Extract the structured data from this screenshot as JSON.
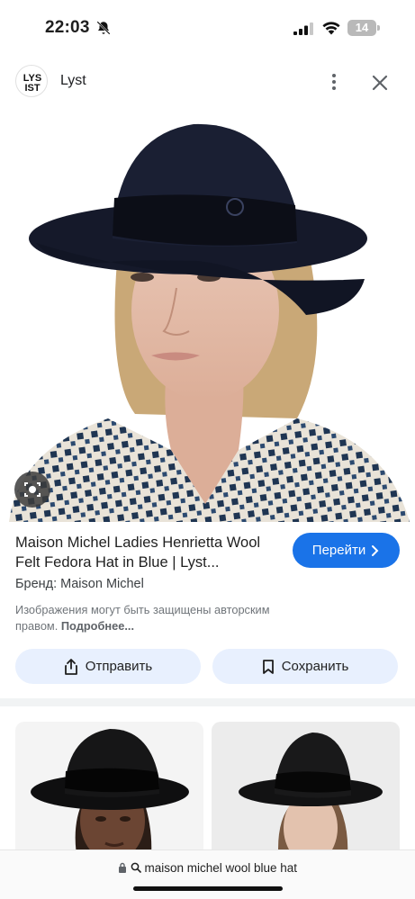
{
  "status_bar": {
    "time": "22:03",
    "battery": "14"
  },
  "header": {
    "logo_text_top": "LYS",
    "logo_text_bottom": "IST",
    "site_name": "Lyst"
  },
  "result": {
    "title": "Maison Michel Ladies Henrietta Wool Felt Fedora Hat in Blue | Lyst...",
    "go_label": "Перейти",
    "brand": "Бренд: Maison Michel",
    "copyright_text": "Изображения могут быть защищены авторским правом.",
    "more_link": "Подробнее...",
    "share_label": "Отправить",
    "save_label": "Сохранить"
  },
  "address_bar": {
    "query": "maison michel wool blue hat"
  },
  "icons": {
    "bell": "bell-off-icon",
    "signal": "signal-icon",
    "wifi": "wifi-icon",
    "more": "more-vert-icon",
    "close": "close-icon",
    "lens": "lens-icon",
    "share": "share-icon",
    "bookmark": "bookmark-icon",
    "lock": "lock-icon",
    "search": "search-icon"
  },
  "colors": {
    "accent": "#1a73e8",
    "button_tint": "#e8f0fe"
  }
}
